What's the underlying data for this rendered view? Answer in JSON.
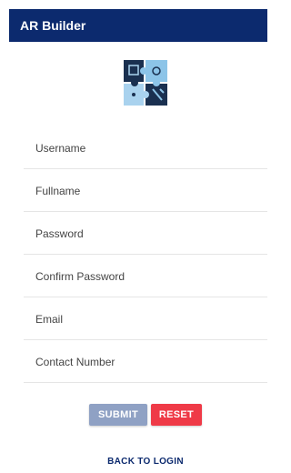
{
  "app": {
    "title": "AR Builder"
  },
  "logo": {
    "icon": "puzzle-logo-icon"
  },
  "form": {
    "fields": [
      {
        "name": "username",
        "placeholder": "Username",
        "value": ""
      },
      {
        "name": "fullname",
        "placeholder": "Fullname",
        "value": ""
      },
      {
        "name": "password",
        "placeholder": "Password",
        "value": ""
      },
      {
        "name": "confirm-password",
        "placeholder": "Confirm Password",
        "value": ""
      },
      {
        "name": "email",
        "placeholder": "Email",
        "value": ""
      },
      {
        "name": "contact-number",
        "placeholder": "Contact Number",
        "value": ""
      }
    ],
    "submit_label": "SUBMIT",
    "reset_label": "RESET"
  },
  "back_link": "BACK TO LOGIN",
  "colors": {
    "appbar": "#0c2a6e",
    "submit": "#8fa1c4",
    "reset": "#ef3a47",
    "link": "#0c2a6e"
  }
}
